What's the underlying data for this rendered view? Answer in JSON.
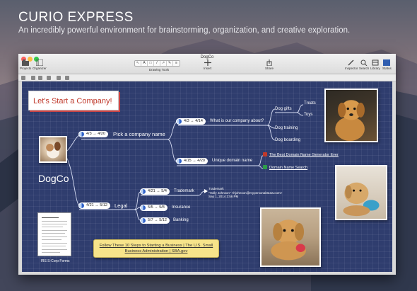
{
  "hero": {
    "title": "CURIO EXPRESS",
    "subtitle": "An incredibly powerful environment for brainstorming, organization, and creative exploration."
  },
  "window": {
    "title": "DogCo",
    "toolbar": {
      "projects": "Projects",
      "organizer": "Organizer",
      "drawing_tools": "Drawing Tools",
      "insert": "Insert",
      "share": "Share",
      "inspector": "Inspector",
      "search": "Search",
      "library": "Library",
      "status": "Status"
    }
  },
  "canvas": {
    "start_card": "Let's Start a Company!",
    "center": "DogCo",
    "branches": {
      "pick_name": {
        "label": "Pick a company name",
        "dates": "4/3 → 4/20"
      },
      "what_is": {
        "label": "What is our company about?",
        "dates": "4/3 → 4/14"
      },
      "dog_gifts": "Dog gifts",
      "treats": "Treats",
      "toys": "Toys",
      "dog_training": "Dog training",
      "dog_boarding": "Dog boarding",
      "unique_domain": {
        "label": "Unique domain name",
        "dates": "4/15 → 4/20"
      },
      "domain_generator": "The Best Domain Name Generator Ever",
      "domain_search": "Domain Name Search",
      "legal": {
        "label": "Legal",
        "dates": "4/21 → 5/12"
      },
      "trademark": {
        "label": "Trademark",
        "dates": "4/21 → 5/4"
      },
      "insurance": {
        "label": "Insurance",
        "dates": "5/5 → 5/8"
      },
      "banking": {
        "label": "Banking",
        "dates": "5/7 → 5/12"
      }
    },
    "trademark_note": {
      "title": "Trademark",
      "from": "\"Holly Johnson\" <hjohnson@mypersonal32aw.com>",
      "date": "Sep 1, 2014 3:56 PM"
    },
    "sticky": "Follow These 10 Steps to Starting a Business | The U.S. Small Business Administration | SBA.gov",
    "doc_label": "IRS S-Corp Forms"
  },
  "colors": {
    "canvas": "#2f3d6e",
    "link_red": "#c0392b",
    "link_green": "#2e9e4a",
    "sticky": "#f7e48a"
  }
}
